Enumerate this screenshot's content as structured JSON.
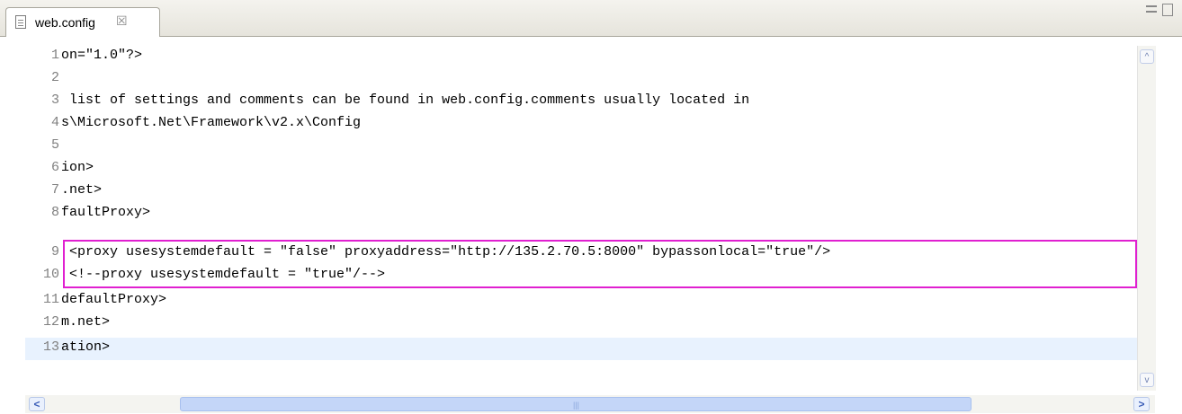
{
  "tab": {
    "label": "web.config",
    "close_glyph": "☒"
  },
  "window_controls": [
    "minimize-icon",
    "maximize-icon"
  ],
  "lines": [
    {
      "n": "1",
      "text": "on=\"1.0\"?>"
    },
    {
      "n": "2",
      "text": ""
    },
    {
      "n": "3",
      "text": " list of settings and comments can be found in web.config.comments usually located in"
    },
    {
      "n": "4",
      "text": "s\\Microsoft.Net\\Framework\\v2.x\\Config"
    },
    {
      "n": "5",
      "text": ""
    },
    {
      "n": "6",
      "text": "ion>"
    },
    {
      "n": "7",
      "text": ".net>"
    },
    {
      "n": "8",
      "text": "faultProxy>"
    },
    {
      "n": "9",
      "text": " <proxy usesystemdefault = \"false\" proxyaddress=\"http://135.2.70.5:8000\" bypassonlocal=\"true\"/>"
    },
    {
      "n": "10",
      "text": " <!--proxy usesystemdefault = \"true\"/-->"
    },
    {
      "n": "11",
      "text": "defaultProxy>"
    },
    {
      "n": "12",
      "text": "m.net>"
    },
    {
      "n": "13",
      "text": "ation>"
    }
  ],
  "current_line": "13",
  "scroll": {
    "left": "<",
    "right": ">",
    "up": "^",
    "down": "v",
    "grip": "|||"
  },
  "colors": {
    "highlight_box": "#e020d0",
    "current_line_bg": "#e8f2fe",
    "line_number": "#808080"
  }
}
